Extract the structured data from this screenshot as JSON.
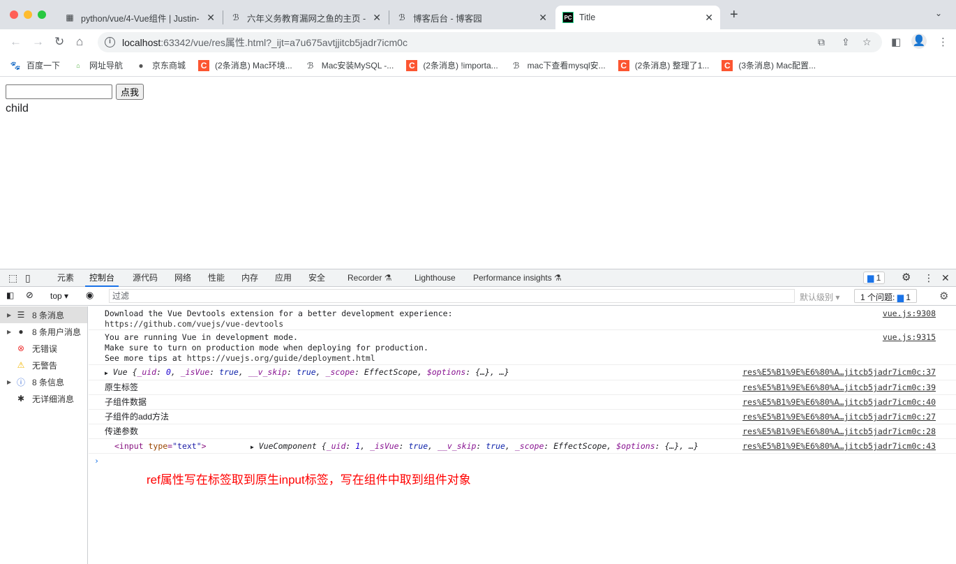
{
  "browser": {
    "tabs": [
      {
        "title": "python/vue/4-Vue组件 | Justin-",
        "icon": "qr-favicon"
      },
      {
        "title": "六年义务教育漏网之鱼的主页 - 博",
        "icon": "cnblogs-favicon"
      },
      {
        "title": "博客后台 - 博客园",
        "icon": "cnblogs-favicon"
      },
      {
        "title": "Title",
        "icon": "pycharm-favicon",
        "active": true
      }
    ],
    "url_host": "localhost",
    "url_path": ":63342/vue/res属性.html?_ijt=a7u675avtjjitcb5jadr7icm0c",
    "bookmarks": [
      {
        "label": "百度一下",
        "icon": "baidu-icon"
      },
      {
        "label": "网址导航",
        "icon": "2345-icon"
      },
      {
        "label": "京东商城",
        "icon": "globe-icon"
      },
      {
        "label": "(2条消息) Mac环境...",
        "icon": "csdn-icon"
      },
      {
        "label": "Mac安装MySQL -...",
        "icon": "cnblogs-icon"
      },
      {
        "label": "(2条消息) !importa...",
        "icon": "csdn-icon"
      },
      {
        "label": "mac下查看mysql安...",
        "icon": "cnblogs-icon"
      },
      {
        "label": "(2条消息) 整理了1...",
        "icon": "csdn-icon"
      },
      {
        "label": "(3条消息) Mac配置...",
        "icon": "csdn-icon"
      }
    ]
  },
  "page": {
    "button": "点我",
    "child": "child",
    "input_value": ""
  },
  "devtools": {
    "tabs": [
      "元素",
      "控制台",
      "源代码",
      "网络",
      "性能",
      "内存",
      "应用",
      "安全",
      "Recorder ⚗",
      "Lighthouse",
      "Performance insights ⚗"
    ],
    "issues_badge": "1",
    "context": "top ▾",
    "filter_placeholder": "过滤",
    "level": "默认级别 ▾",
    "issues_label": "1 个问题:",
    "issues_count": "1",
    "sidebar": [
      "8 条消息",
      "8 条用户消息",
      "无错误",
      "无警告",
      "8 条信息",
      "无详细消息"
    ],
    "logs": {
      "l1a": "Download the Vue Devtools extension for a better development experience:",
      "l1b": "https://github.com/vuejs/vue-devtools",
      "l1src": "vue.js:9308",
      "l2a": "You are running Vue in development mode.",
      "l2b": "Make sure to turn on production mode when deploying for production.",
      "l2c": "See more tips at ",
      "l2d": "https://vuejs.org/guide/deployment.html",
      "l2src": "vue.js:9315",
      "l3": [
        "Vue {",
        "_uid",
        ": ",
        "0",
        ", ",
        "_isVue",
        ": ",
        "true",
        ", ",
        "__v_skip",
        ": ",
        "true",
        ", ",
        "_scope",
        ": EffectScope, ",
        "$options",
        ": {…}, …}"
      ],
      "l3src": "res%E5%B1%9E%E6%80%A…jitcb5jadr7icm0c:37",
      "l4": "原生标签",
      "l4src": "res%E5%B1%9E%E6%80%A…jitcb5jadr7icm0c:39",
      "l5": "子组件数据",
      "l5src": "res%E5%B1%9E%E6%80%A…jitcb5jadr7icm0c:40",
      "l6": "子组件的add方法",
      "l6src": "res%E5%B1%9E%E6%80%A…jitcb5jadr7icm0c:27",
      "l7": "传递参数",
      "l7src": "res%E5%B1%9E%E6%80%A…jitcb5jadr7icm0c:28",
      "l8tag": "<input",
      "l8attr": " type",
      "l8eq": "=",
      "l8val": "\"text\"",
      "l8end": ">",
      "l8": [
        "VueComponent {",
        "_uid",
        ": ",
        "1",
        ", ",
        "_isVue",
        ": ",
        "true",
        ", ",
        "__v_skip",
        ": ",
        "true",
        ", ",
        "_scope",
        ": EffectScope, ",
        "$options",
        ": {…}, …}"
      ],
      "l8src": "res%E5%B1%9E%E6%80%A…jitcb5jadr7icm0c:43"
    }
  },
  "annotation": "ref属性写在标签取到原生input标签，写在组件中取到组件对象"
}
